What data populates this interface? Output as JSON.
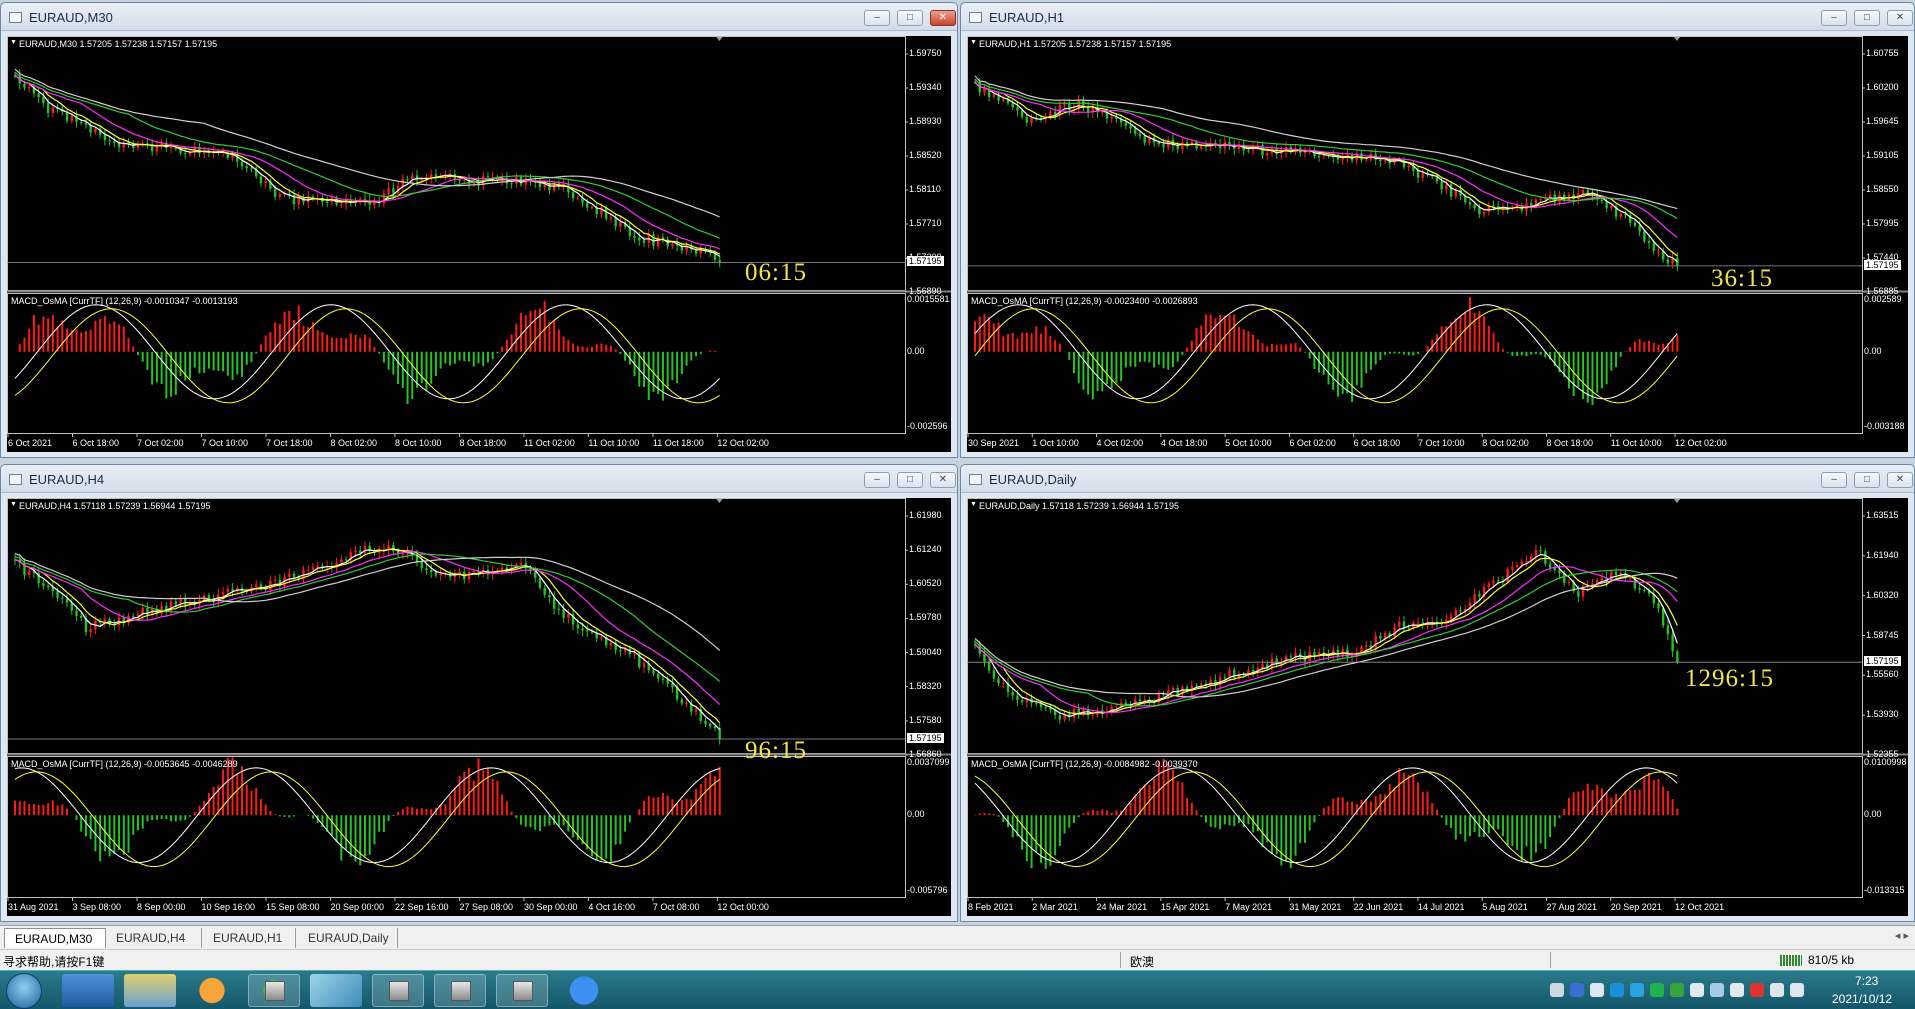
{
  "windows": [
    {
      "title": "EURAUD,M30",
      "ohlc": "EURAUD,M30  1.57205 1.57238 1.57157 1.57195",
      "macd": "MACD_OsMA [CurrTF] (12,26,9) -0.0010347 -0.0013193",
      "countdown": "06:15",
      "bid": "1.57195",
      "prices": [
        "1.59750",
        "1.59340",
        "1.58930",
        "1.58520",
        "1.58110",
        "1.57710",
        "1.57300",
        "1.56890"
      ],
      "macd_scale": [
        "0.0015581",
        "0.00",
        "-0.002596"
      ],
      "times": [
        "6 Oct 2021",
        "6 Oct 18:00",
        "7 Oct 02:00",
        "7 Oct 10:00",
        "7 Oct 18:00",
        "8 Oct 02:00",
        "8 Oct 10:00",
        "8 Oct 18:00",
        "11 Oct 02:00",
        "11 Oct 10:00",
        "11 Oct 18:00",
        "12 Oct 02:00"
      ]
    },
    {
      "title": "EURAUD,H1",
      "ohlc": "EURAUD,H1  1.57205 1.57238 1.57157 1.57195",
      "macd": "MACD_OsMA [CurrTF] (12,26,9) -0.0023400 -0.0026893",
      "countdown": "36:15",
      "bid": "1.57195",
      "prices": [
        "1.60755",
        "1.60200",
        "1.59645",
        "1.59105",
        "1.58550",
        "1.57995",
        "1.57440",
        "1.56885"
      ],
      "macd_scale": [
        "0.002589",
        "0.00",
        "-0.003188"
      ],
      "times": [
        "30 Sep 2021",
        "1 Oct 10:00",
        "4 Oct 02:00",
        "4 Oct 18:00",
        "5 Oct 10:00",
        "6 Oct 02:00",
        "6 Oct 18:00",
        "7 Oct 10:00",
        "8 Oct 02:00",
        "8 Oct 18:00",
        "11 Oct 10:00",
        "12 Oct 02:00"
      ]
    },
    {
      "title": "EURAUD,H4",
      "ohlc": "EURAUD,H4  1.57118 1.57239 1.56944 1.57195",
      "macd": "MACD_OsMA [CurrTF] (12,26,9) -0.0053645 -0.0046289",
      "countdown": "96:15",
      "bid": "1.57195",
      "prices": [
        "1.61980",
        "1.61240",
        "1.60520",
        "1.59780",
        "1.59040",
        "1.58320",
        "1.57580",
        "1.56860"
      ],
      "macd_scale": [
        "0.0037099",
        "0.00",
        "-0.005796"
      ],
      "times": [
        "31 Aug 2021",
        "3 Sep 08:00",
        "8 Sep 00:00",
        "10 Sep 16:00",
        "15 Sep 08:00",
        "20 Sep 00:00",
        "22 Sep 16:00",
        "27 Sep 08:00",
        "30 Sep 00:00",
        "4 Oct 16:00",
        "7 Oct 08:00",
        "12 Oct 00:00"
      ]
    },
    {
      "title": "EURAUD,Daily",
      "ohlc": "EURAUD,Daily  1.57118 1.57239 1.56944 1.57195",
      "macd": "MACD_OsMA [CurrTF] (12,26,9) -0.0084982 -0.0039370",
      "countdown": "1296:15",
      "bid": "1.57195",
      "prices": [
        "1.63515",
        "1.61940",
        "1.60320",
        "1.58745",
        "1.55560",
        "1.53930",
        "1.52355"
      ],
      "macd_scale": [
        "0.0100998",
        "0.00",
        "-0.013315"
      ],
      "times": [
        "8 Feb 2021",
        "2 Mar 2021",
        "24 Mar 2021",
        "15 Apr 2021",
        "7 May 2021",
        "31 May 2021",
        "22 Jun 2021",
        "14 Jul 2021",
        "5 Aug 2021",
        "27 Aug 2021",
        "20 Sep 2021",
        "12 Oct 2021"
      ]
    }
  ],
  "tabs": [
    "EURAUD,M30",
    "EURAUD,H4",
    "EURAUD,H1",
    "EURAUD,Daily"
  ],
  "status": {
    "help": "寻求帮助,请按F1键",
    "profile": "欧澳",
    "traffic": "810/5 kb"
  },
  "taskbar": {
    "time": "7:23",
    "date": "2021/10/12"
  },
  "colors": {
    "bull": "#ff1a1a",
    "bear": "#22c322",
    "ma_fast": "#ffffff",
    "ma_2": "#ffff33",
    "ma_3": "#ff2bff",
    "ma_4": "#33cc33",
    "ma_5": "#cfcfcf",
    "countdown": "#f2e54d"
  },
  "icons": {
    "window": "window-icon",
    "minimize": "minimize-icon",
    "restore": "restore-icon",
    "close": "close-icon",
    "start": "windows-start-icon"
  }
}
